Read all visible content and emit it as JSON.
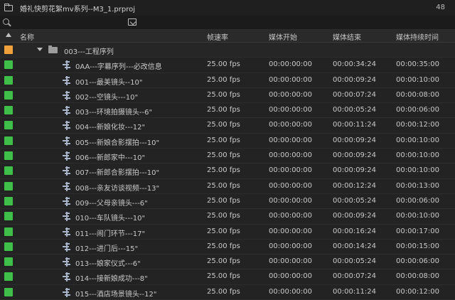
{
  "window": {
    "title": "婚礼快剪花絮mv系列--M3_1.prproj",
    "item_count": "48"
  },
  "search": {
    "value": "",
    "placeholder": ""
  },
  "columns": {
    "name": "名称",
    "fps": "帧速率",
    "media_start": "媒体开始",
    "media_end": "媒体结束",
    "media_duration": "媒体持续时间"
  },
  "colors": {
    "folder_label": "#f0a13c",
    "sequence_label": "#3fbf4a"
  },
  "folder": {
    "name": "003---工程序列"
  },
  "rows": [
    {
      "name": "0AA---字幕序列---必改信息",
      "fps": "25.00 fps",
      "start": "00:00:00:00",
      "end": "00:00:34:24",
      "duration": "00:00:35:00"
    },
    {
      "name": "001---最美镜头--10\"",
      "fps": "25.00 fps",
      "start": "00:00:00:00",
      "end": "00:00:09:24",
      "duration": "00:00:10:00"
    },
    {
      "name": "002---空镜头---10\"",
      "fps": "25.00 fps",
      "start": "00:00:00:00",
      "end": "00:00:07:24",
      "duration": "00:00:08:00"
    },
    {
      "name": "003---环境拍摄镜头--6\"",
      "fps": "25.00 fps",
      "start": "00:00:00:00",
      "end": "00:00:05:24",
      "duration": "00:00:06:00"
    },
    {
      "name": "004---新娘化妆---12\"",
      "fps": "25.00 fps",
      "start": "00:00:00:00",
      "end": "00:00:11:24",
      "duration": "00:00:12:00"
    },
    {
      "name": "005---新娘合影摆拍---10\"",
      "fps": "25.00 fps",
      "start": "00:00:00:00",
      "end": "00:00:09:24",
      "duration": "00:00:10:00"
    },
    {
      "name": "006---新郎家中---10\"",
      "fps": "25.00 fps",
      "start": "00:00:00:00",
      "end": "00:00:09:24",
      "duration": "00:00:10:00"
    },
    {
      "name": "007---新郎合影摆拍---10\"",
      "fps": "25.00 fps",
      "start": "00:00:00:00",
      "end": "00:00:09:24",
      "duration": "00:00:10:00"
    },
    {
      "name": "008---亲友访谈视频---13\"",
      "fps": "25.00 fps",
      "start": "00:00:00:00",
      "end": "00:00:12:24",
      "duration": "00:00:13:00"
    },
    {
      "name": "009---父母亲镜头---6\"",
      "fps": "25.00 fps",
      "start": "00:00:00:00",
      "end": "00:00:05:24",
      "duration": "00:00:06:00"
    },
    {
      "name": "010---车队镜头---10\"",
      "fps": "25.00 fps",
      "start": "00:00:00:00",
      "end": "00:00:09:24",
      "duration": "00:00:10:00"
    },
    {
      "name": "011---闹门环节---17\"",
      "fps": "25.00 fps",
      "start": "00:00:00:00",
      "end": "00:00:16:24",
      "duration": "00:00:17:00"
    },
    {
      "name": "012---进门后---15\"",
      "fps": "25.00 fps",
      "start": "00:00:00:00",
      "end": "00:00:14:24",
      "duration": "00:00:15:00"
    },
    {
      "name": "013---娘家仪式---6\"",
      "fps": "25.00 fps",
      "start": "00:00:00:00",
      "end": "00:00:05:24",
      "duration": "00:00:06:00"
    },
    {
      "name": "014---接新娘成功---8\"",
      "fps": "25.00 fps",
      "start": "00:00:00:00",
      "end": "00:00:07:24",
      "duration": "00:00:08:00"
    },
    {
      "name": "015---酒店场景镜头--12\"",
      "fps": "25.00 fps",
      "start": "00:00:00:00",
      "end": "00:00:11:24",
      "duration": "00:00:12:00"
    }
  ]
}
